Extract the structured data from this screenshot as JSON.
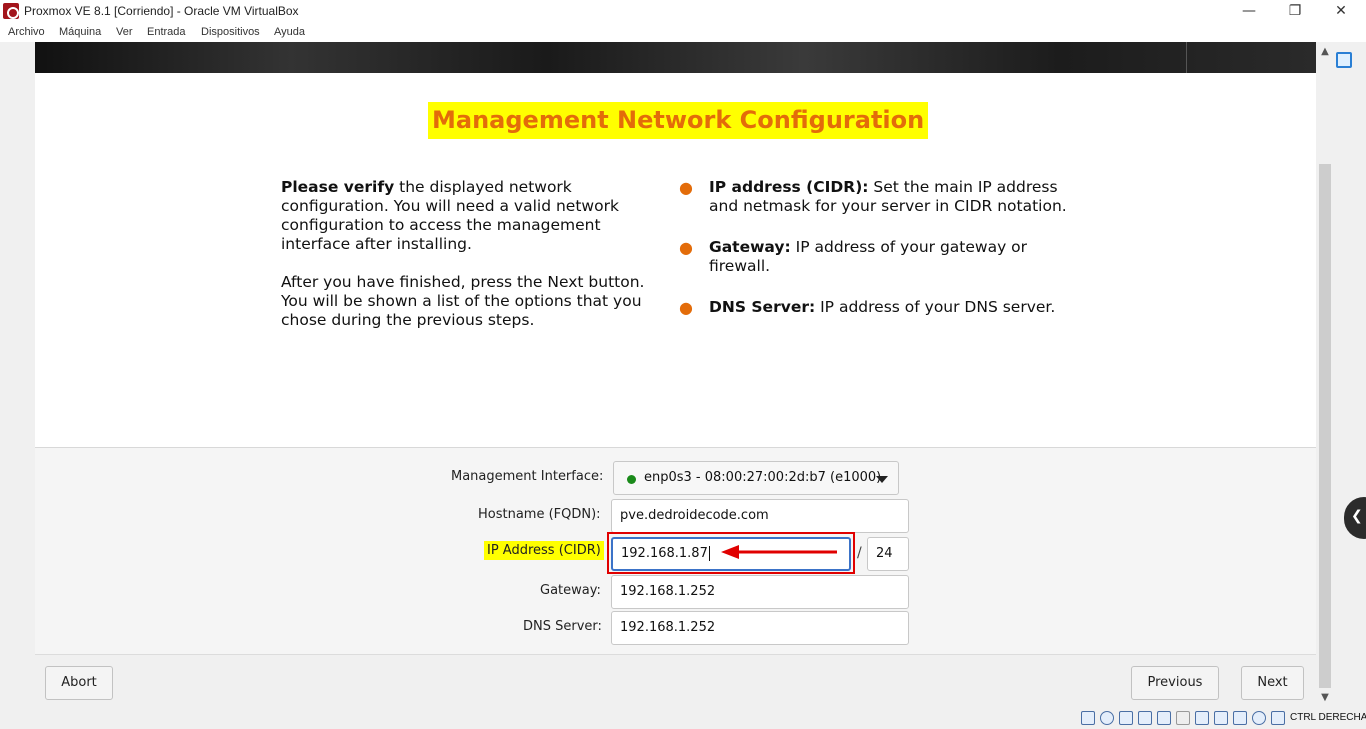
{
  "window": {
    "title": "Proxmox VE 8.1 [Corriendo] - Oracle VM VirtualBox",
    "minimize_glyph": "—",
    "restore_glyph": "❐",
    "close_glyph": "✕"
  },
  "menubar": {
    "items": [
      "Archivo",
      "Máquina",
      "Ver",
      "Entrada",
      "Dispositivos",
      "Ayuda"
    ]
  },
  "installer": {
    "heading": "Management Network Configuration",
    "intro": {
      "p1_bold": "Please verify",
      "p1_rest": " the displayed network configuration. You will need a valid network configuration to access the management interface after installing.",
      "p2": "After you have finished, press the Next button. You will be shown a list of the options that you chose during the previous steps."
    },
    "bullets": [
      {
        "term": "IP address (CIDR):",
        "text": " Set the main IP address and netmask for your server in CIDR notation."
      },
      {
        "term": "Gateway:",
        "text": " IP address of your gateway or firewall."
      },
      {
        "term": "DNS Server:",
        "text": " IP address of your DNS server."
      }
    ],
    "form": {
      "interface_label": "Management Interface:",
      "interface_value": "enp0s3 - 08:00:27:00:2d:b7 (e1000)",
      "hostname_label": "Hostname (FQDN):",
      "hostname_value": "pve.dedroidecode.com",
      "ip_label": "IP Address (CIDR)",
      "ip_value": "192.168.1.87",
      "cidr_separator": "/",
      "cidr_value": "24",
      "gateway_label": "Gateway:",
      "gateway_value": "192.168.1.252",
      "dns_label": "DNS Server:",
      "dns_value": "192.168.1.252"
    },
    "buttons": {
      "abort": "Abort",
      "previous": "Previous",
      "next": "Next"
    }
  },
  "annotation": {
    "highlight_color": "#ffff00",
    "box_color": "#e00000",
    "arrow_color": "#e00000"
  },
  "statusbar": {
    "host_key": "CTRL DERECHA"
  },
  "colors": {
    "heading_text": "#e36c0a",
    "bullet": "#e36c0a",
    "link_state_dot": "#1a8a1a"
  }
}
